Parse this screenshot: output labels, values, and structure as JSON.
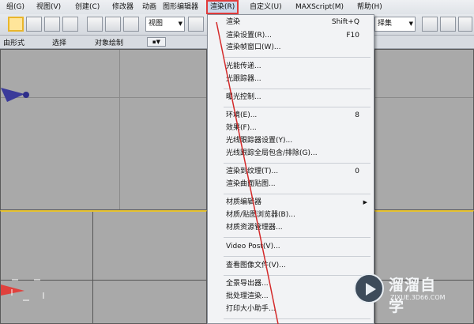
{
  "menubar": {
    "items": [
      "组(G)",
      "视图(V)",
      "创建(C)",
      "修改器",
      "动画",
      "图形编辑器",
      "渲染(R)",
      "自定义(U)",
      "MAXScript(M)",
      "帮助(H)"
    ],
    "active": "渲染(R)"
  },
  "toolbar": {
    "view_combo": "视图",
    "selection_set_combo": "择集"
  },
  "ribbon": {
    "labels": [
      "由形式",
      "选择",
      "对象绘制"
    ]
  },
  "render_menu": {
    "items": [
      {
        "label": "渲染",
        "shortcut": "Shift+Q"
      },
      {
        "label": "渲染设置(R)...",
        "shortcut": "F10"
      },
      {
        "label": "渲染帧窗口(W)..."
      },
      {
        "label": "光能传递..."
      },
      {
        "label": "光跟踪器..."
      },
      {
        "label": "曝光控制..."
      },
      {
        "label": "环境(E)...",
        "shortcut": "8"
      },
      {
        "label": "效果(F)..."
      },
      {
        "label": "光线跟踪器设置(Y)..."
      },
      {
        "label": "光线跟踪全局包含/排除(G)..."
      },
      {
        "label": "渲染到纹理(T)...",
        "shortcut": "0"
      },
      {
        "label": "渲染曲面贴图..."
      },
      {
        "label": "材质编辑器",
        "submenu": true
      },
      {
        "label": "材质/贴图浏览器(B)..."
      },
      {
        "label": "材质资源管理器..."
      },
      {
        "label": "Video Post(V)..."
      },
      {
        "label": "查看图像文件(V)..."
      },
      {
        "label": "全景导出器..."
      },
      {
        "label": "批处理渲染..."
      },
      {
        "label": "打印大小助手..."
      }
    ]
  },
  "watermark": {
    "title": "溜溜自学",
    "url": "ZIXUE.3D66.COM"
  },
  "colors": {
    "highlight_border": "#e23b3b",
    "selected_tool": "#ffe59a",
    "annotation_line": "#d42a2a",
    "viewport_bg": "#a9a9a9"
  }
}
